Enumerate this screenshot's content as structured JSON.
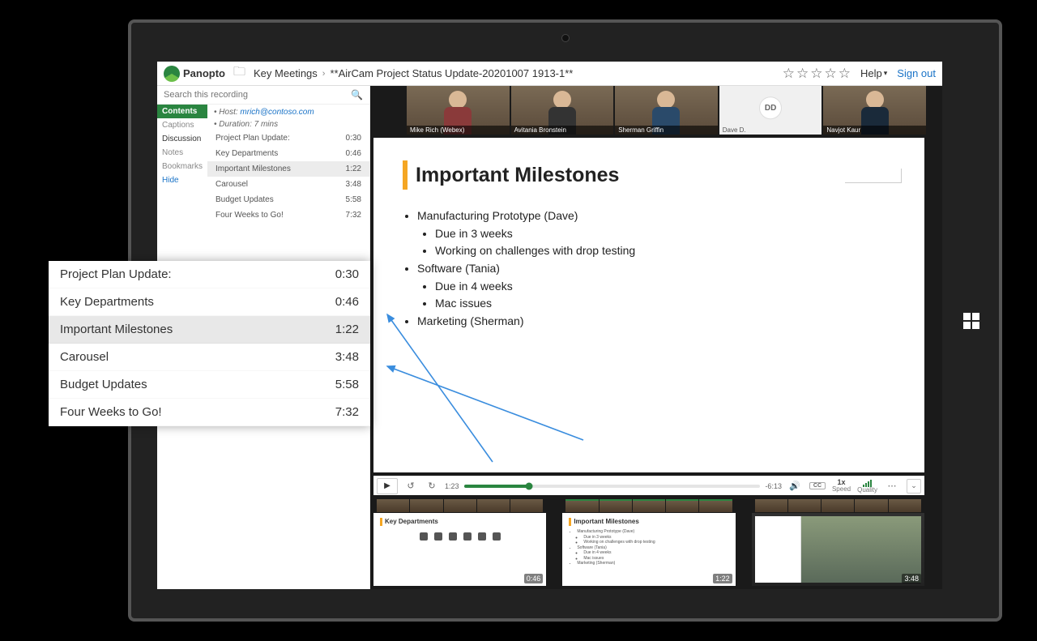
{
  "brand": "Panopto",
  "breadcrumb": {
    "folder": "Key Meetings",
    "title": "**AirCam Project Status Update-20201007 1913-1**"
  },
  "header": {
    "help": "Help",
    "signout": "Sign out"
  },
  "search": {
    "placeholder": "Search this recording"
  },
  "sidebarTabs": {
    "contents": "Contents",
    "captions": "Captions",
    "discussion": "Discussion",
    "notes": "Notes",
    "bookmarks": "Bookmarks",
    "hide": "Hide"
  },
  "meta": {
    "hostLabel": "Host:",
    "hostEmail": "mrich@contoso.com",
    "duration": "Duration: 7 mins"
  },
  "toc": [
    {
      "label": "Project Plan Update:",
      "time": "0:30"
    },
    {
      "label": "Key Departments",
      "time": "0:46"
    },
    {
      "label": "Important Milestones",
      "time": "1:22",
      "selected": true
    },
    {
      "label": "Carousel",
      "time": "3:48"
    },
    {
      "label": "Budget Updates",
      "time": "5:58"
    },
    {
      "label": "Four Weeks to Go!",
      "time": "7:32"
    }
  ],
  "participants": [
    {
      "name": "Mike Rich (Webex)"
    },
    {
      "name": "Avitania Bronstein"
    },
    {
      "name": "Sherman Griffin"
    },
    {
      "name": "Dave D.",
      "initials": "DD",
      "placeholder": true
    },
    {
      "name": "Navjot Kaur"
    }
  ],
  "slide": {
    "title": "Important Milestones",
    "b1": "Manufacturing Prototype (Dave)",
    "b1a": "Due in 3 weeks",
    "b1b": "Working on challenges with drop testing",
    "b2": "Software (Tania)",
    "b2a": "Due in 4 weeks",
    "b2b": "Mac issues",
    "b3": "Marketing (Sherman)"
  },
  "player": {
    "current": "1:23",
    "remaining": "-6:13",
    "speed": "1x",
    "speedLabel": "Speed",
    "qualityLabel": "Quality",
    "cc": "CC"
  },
  "thumbs": [
    {
      "title": "Key Departments",
      "time": "0:46"
    },
    {
      "title": "Important Milestones",
      "time": "1:22"
    },
    {
      "title": "",
      "time": "3:48"
    }
  ],
  "thumb2lines": {
    "a": "Manufacturing Prototype (Dave)",
    "b": "Due in 3 weeks",
    "c": "Working on challenges with drop testing",
    "d": "Software (Tania)",
    "e": "Due in 4 weeks",
    "f": "Mac issues",
    "g": "Marketing (Sherman)"
  },
  "popup": [
    {
      "label": "Project Plan Update:",
      "time": "0:30"
    },
    {
      "label": "Key Departments",
      "time": "0:46"
    },
    {
      "label": "Important Milestones",
      "time": "1:22",
      "selected": true
    },
    {
      "label": "Carousel",
      "time": "3:48"
    },
    {
      "label": "Budget Updates",
      "time": "5:58"
    },
    {
      "label": "Four Weeks to Go!",
      "time": "7:32"
    }
  ]
}
